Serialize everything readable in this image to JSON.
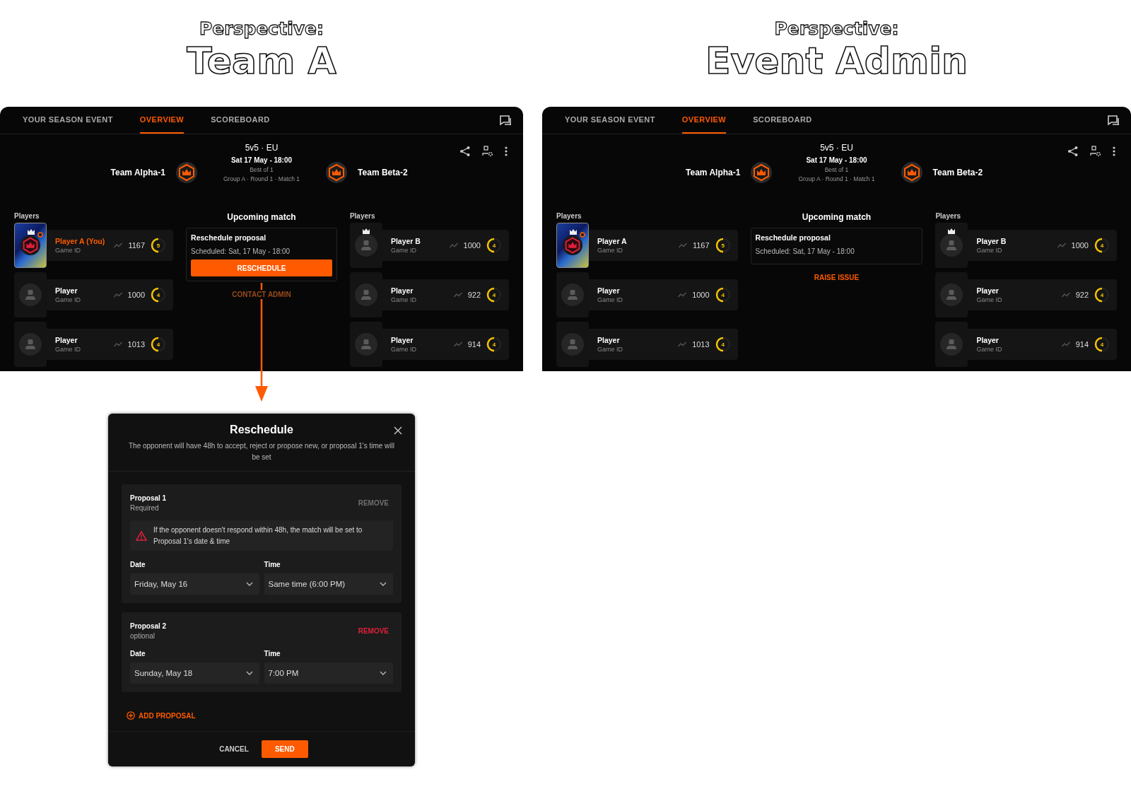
{
  "perspectives": [
    {
      "label": "Perspective:",
      "title": "Team A",
      "screen": {
        "tabs": [
          {
            "label": "YOUR SEASON EVENT",
            "selected": false
          },
          {
            "label": "OVERVIEW",
            "selected": true
          },
          {
            "label": "SCOREBOARD",
            "selected": false
          }
        ],
        "match": {
          "format": "5v5 · EU",
          "datetime": "Sat 17 May - 18:00",
          "best_of": "Best of 1",
          "stage": "Group A · Round 1 · Match 1"
        },
        "teams": [
          {
            "name": "Team Alpha-1"
          },
          {
            "name": "Team Beta-2"
          }
        ],
        "rosters": [
          {
            "heading": "Players",
            "players": [
              {
                "name": "Player A (You)",
                "game_id": "Game ID",
                "rating": "1167",
                "rank": "5",
                "you": true,
                "captain": true,
                "kind": "art"
              },
              {
                "name": "Player",
                "game_id": "Game ID",
                "rating": "1000",
                "rank": "4",
                "you": false,
                "captain": false,
                "kind": "default"
              },
              {
                "name": "Player",
                "game_id": "Game ID",
                "rating": "1013",
                "rank": "4",
                "you": false,
                "captain": false,
                "kind": "default"
              }
            ]
          },
          {
            "heading": "Players",
            "players": [
              {
                "name": "Player B",
                "game_id": "Game ID",
                "rating": "1000",
                "rank": "4",
                "you": false,
                "captain": true,
                "kind": "default"
              },
              {
                "name": "Player",
                "game_id": "Game ID",
                "rating": "922",
                "rank": "4",
                "you": false,
                "captain": false,
                "kind": "default"
              },
              {
                "name": "Player",
                "game_id": "Game ID",
                "rating": "914",
                "rank": "4",
                "you": false,
                "captain": false,
                "kind": "default"
              }
            ]
          }
        ],
        "upcoming": {
          "heading": "Upcoming match",
          "proposal_title": "Reschedule proposal",
          "scheduled": "Scheduled: Sat, 17 May - 18:00",
          "button": "RESCHEDULE",
          "link": {
            "label": "CONTACT ADMIN",
            "disabled": true
          }
        }
      }
    },
    {
      "label": "Perspective:",
      "title": "Event Admin",
      "screen": {
        "tabs": [
          {
            "label": "YOUR SEASON EVENT",
            "selected": false
          },
          {
            "label": "OVERVIEW",
            "selected": true
          },
          {
            "label": "SCOREBOARD",
            "selected": false
          }
        ],
        "match": {
          "format": "5v5 · EU",
          "datetime": "Sat 17 May - 18:00",
          "best_of": "Best of 1",
          "stage": "Group A · Round 1 · Match 1"
        },
        "teams": [
          {
            "name": "Team Alpha-1"
          },
          {
            "name": "Team Beta-2"
          }
        ],
        "rosters": [
          {
            "heading": "Players",
            "players": [
              {
                "name": "Player A",
                "game_id": "Game ID",
                "rating": "1167",
                "rank": "5",
                "you": false,
                "captain": true,
                "kind": "art"
              },
              {
                "name": "Player",
                "game_id": "Game ID",
                "rating": "1000",
                "rank": "4",
                "you": false,
                "captain": false,
                "kind": "default"
              },
              {
                "name": "Player",
                "game_id": "Game ID",
                "rating": "1013",
                "rank": "4",
                "you": false,
                "captain": false,
                "kind": "default"
              }
            ]
          },
          {
            "heading": "Players",
            "players": [
              {
                "name": "Player B",
                "game_id": "Game ID",
                "rating": "1000",
                "rank": "4",
                "you": false,
                "captain": true,
                "kind": "default"
              },
              {
                "name": "Player",
                "game_id": "Game ID",
                "rating": "922",
                "rank": "4",
                "you": false,
                "captain": false,
                "kind": "default"
              },
              {
                "name": "Player",
                "game_id": "Game ID",
                "rating": "914",
                "rank": "4",
                "you": false,
                "captain": false,
                "kind": "default"
              }
            ]
          }
        ],
        "upcoming": {
          "heading": "Upcoming match",
          "proposal_title": "Reschedule proposal",
          "scheduled": "Scheduled: Sat, 17 May - 18:00",
          "link": {
            "label": "RAISE ISSUE",
            "disabled": false
          }
        }
      }
    }
  ],
  "dialog": {
    "title": "Reschedule",
    "subtitle": "The opponent will have 48h to accept, reject or propose new, or proposal 1's time will be set",
    "proposals": [
      {
        "title": "Proposal 1",
        "note": "Required",
        "remove": {
          "label": "REMOVE",
          "disabled": true
        },
        "warning": "If the opponent doesn't respond within 48h, the match will be set to Proposal 1's date & time",
        "date_label": "Date",
        "date": "Friday, May 16",
        "time_label": "Time",
        "time": "Same time (6:00 PM)"
      },
      {
        "title": "Proposal 2",
        "note": "optional",
        "remove": {
          "label": "REMOVE",
          "disabled": false
        },
        "date_label": "Date",
        "date": "Sunday, May 18",
        "time_label": "Time",
        "time": "7:00 PM"
      }
    ],
    "add": "ADD PROPOSAL",
    "cancel": "CANCEL",
    "send": "SEND"
  }
}
